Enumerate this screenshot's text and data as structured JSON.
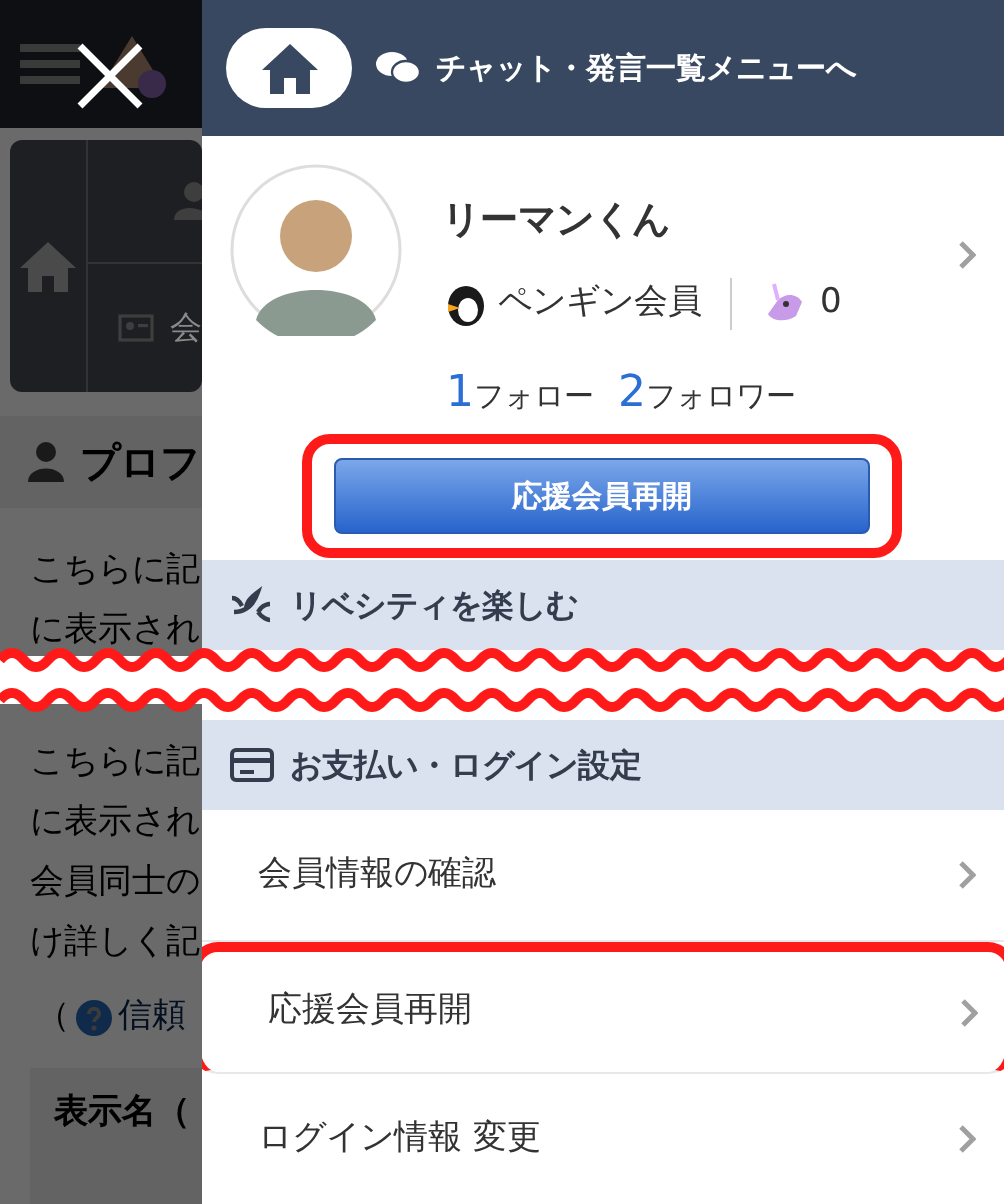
{
  "backdrop": {
    "tile_label": "会",
    "section_title": "プロフ",
    "lines_top": [
      "こちらに記",
      "に表示され"
    ],
    "lines_bottom": [
      "こちらに記",
      "に表示され",
      "会員同士の",
      "け詳しく記"
    ],
    "help_paren": "（",
    "help_link": "信頼",
    "field_label": "表示名（"
  },
  "header": {
    "chat_link": "チャット・発言一覧メニューへ"
  },
  "profile": {
    "name": "リーマンくん",
    "membership": "ペンギン会員",
    "coins": "0",
    "follow_count": "1",
    "follow_label": "フォロー",
    "follower_count": "2",
    "follower_label": "フォロワー",
    "button": {
      "label": "応援会員再開",
      "highlighted": true
    }
  },
  "sections": [
    {
      "kind": "leaf",
      "title": "リベシティを楽しむ"
    },
    {
      "kind": "card",
      "title": "お支払い・ログイン設定",
      "items": [
        {
          "label": "会員情報の確認",
          "highlighted": false
        },
        {
          "label": "応援会員再開",
          "highlighted": true
        },
        {
          "label": "ログイン情報 変更",
          "highlighted": false
        }
      ]
    }
  ]
}
